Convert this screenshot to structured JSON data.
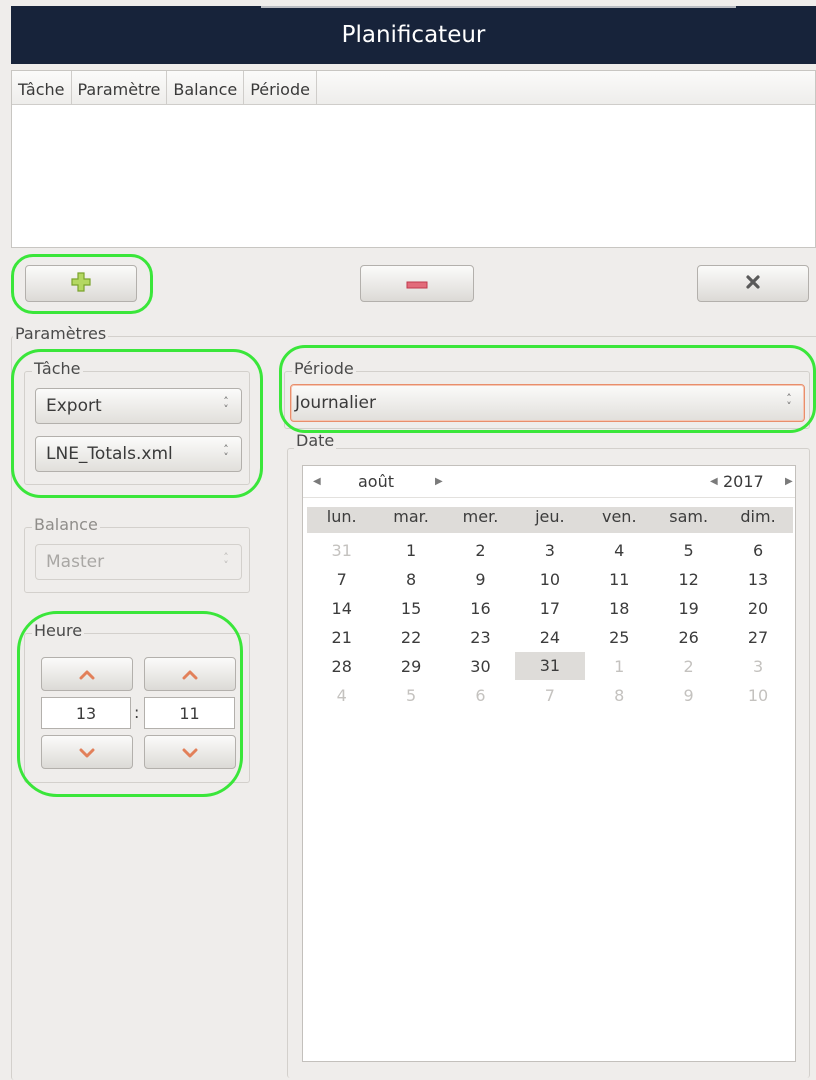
{
  "window": {
    "title": "Planificateur"
  },
  "table": {
    "columns": [
      "Tâche",
      "Paramètre",
      "Balance",
      "Période"
    ]
  },
  "toolbar": {
    "add_icon": "plus-icon",
    "remove_icon": "minus-icon",
    "clear_icon": "x-icon"
  },
  "params": {
    "legend": "Paramètres",
    "tache": {
      "legend": "Tâche",
      "task_value": "Export",
      "param_value": "LNE_Totals.xml"
    },
    "balance": {
      "legend": "Balance",
      "value": "Master"
    },
    "heure": {
      "legend": "Heure",
      "hours": "13",
      "separator": ":",
      "minutes": "11"
    },
    "periode": {
      "legend": "Période",
      "value": "Journalier"
    },
    "date": {
      "legend": "Date",
      "month": "août",
      "year": "2017",
      "weekdays": [
        "lun.",
        "mar.",
        "mer.",
        "jeu.",
        "ven.",
        "sam.",
        "dim."
      ],
      "weeks": [
        [
          "31",
          "1",
          "2",
          "3",
          "4",
          "5",
          "6"
        ],
        [
          "7",
          "8",
          "9",
          "10",
          "11",
          "12",
          "13"
        ],
        [
          "14",
          "15",
          "16",
          "17",
          "18",
          "19",
          "20"
        ],
        [
          "21",
          "22",
          "23",
          "24",
          "25",
          "26",
          "27"
        ],
        [
          "28",
          "29",
          "30",
          "31",
          "1",
          "2",
          "3"
        ],
        [
          "4",
          "5",
          "6",
          "7",
          "8",
          "9",
          "10"
        ]
      ],
      "selected_day": "31"
    }
  },
  "colors": {
    "titlebar": "#17233a",
    "highlight": "#3ae63a",
    "accent": "#e98e6b"
  }
}
